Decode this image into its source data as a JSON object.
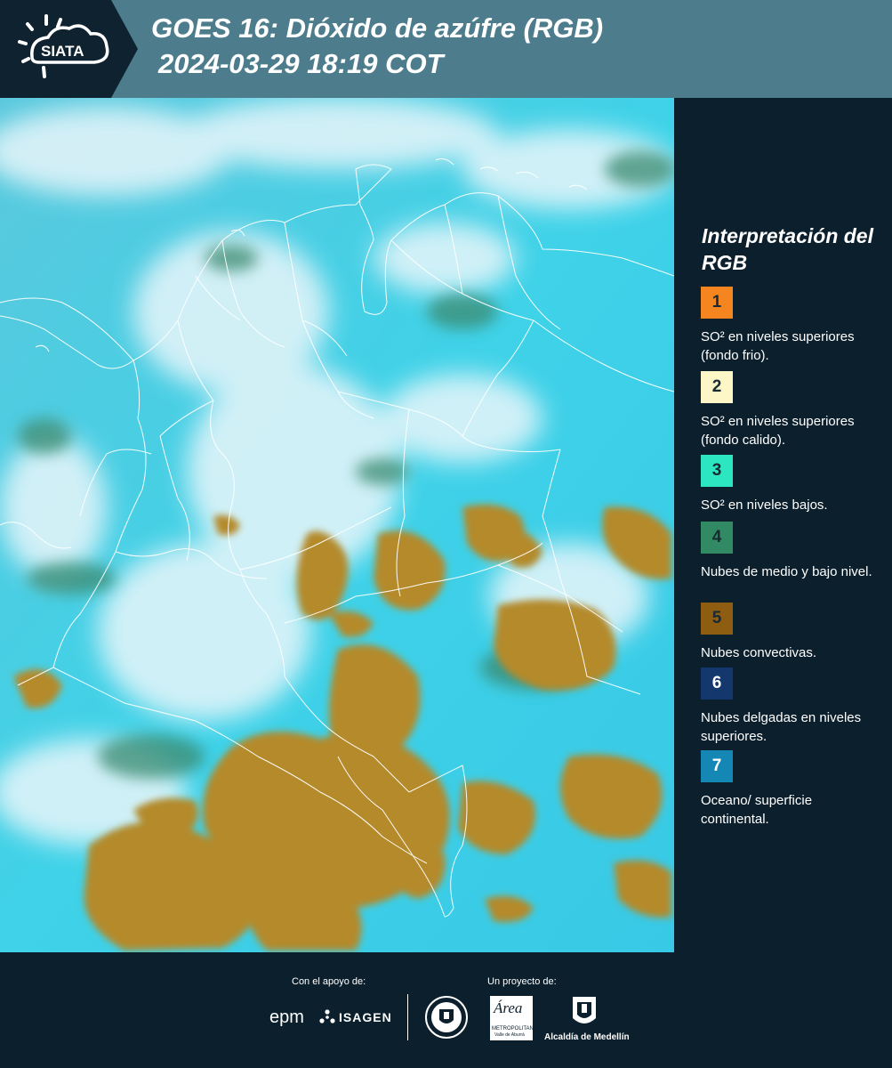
{
  "header": {
    "logo_text": "SIATA",
    "title_line1": "GOES 16: Dióxido de azúfre (RGB)",
    "title_line2": "2024-03-29 18:19 COT"
  },
  "legend": {
    "title": "Interpretación del RGB",
    "items": [
      {
        "number": "1",
        "label": "SO² en niveles superiores (fondo frio).",
        "color": "#f5861f"
      },
      {
        "number": "2",
        "label": "SO² en niveles superiores (fondo calido).",
        "color": "#fdf6c6"
      },
      {
        "number": "3",
        "label": "SO² en niveles bajos.",
        "color": "#2ce5c1"
      },
      {
        "number": "4",
        "label": "Nubes de medio y bajo nivel.",
        "color": "#318a63"
      },
      {
        "number": "5",
        "label": "Nubes convectivas.",
        "color": "#8f5d12"
      },
      {
        "number": "6",
        "label": "Nubes delgadas en niveles superiores.",
        "color": "#14386e"
      },
      {
        "number": "7",
        "label": "Oceano/ superficie continental.",
        "color": "#1487b4"
      }
    ]
  },
  "footer": {
    "support_label": "Con el apoyo de:",
    "project_label": "Un proyecto de:",
    "epm_text": "epm",
    "isagen_text": "ISAGEN",
    "area_text": "Área",
    "area_sub": "METROPOLITANA",
    "area_sub2": "Valle de Aburrá",
    "alcaldia_text": "Alcaldía de Medellín"
  },
  "colors": {
    "header_bg": "#4d7d8d",
    "panel_bg": "#0c1f2c",
    "ocean": "#4fcde4",
    "cloud_white": "#ecf7fa",
    "convective": "#b38b2a"
  }
}
